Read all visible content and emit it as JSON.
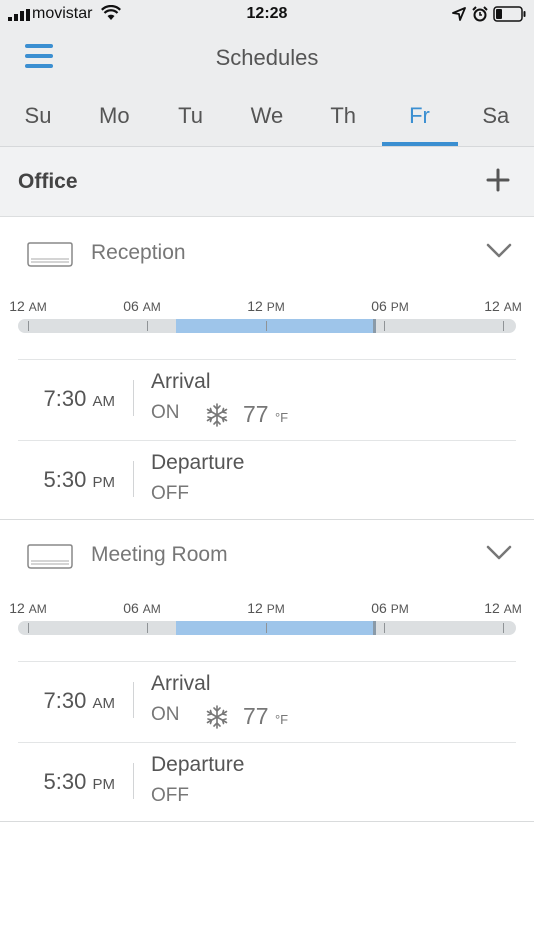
{
  "status_bar": {
    "carrier": "movistar",
    "time": "12:28"
  },
  "nav": {
    "title": "Schedules"
  },
  "days": [
    {
      "label": "Su",
      "active": false
    },
    {
      "label": "Mo",
      "active": false
    },
    {
      "label": "Tu",
      "active": false
    },
    {
      "label": "We",
      "active": false
    },
    {
      "label": "Th",
      "active": false
    },
    {
      "label": "Fr",
      "active": true
    },
    {
      "label": "Sa",
      "active": false
    }
  ],
  "group": {
    "title": "Office"
  },
  "timeline_labels": [
    {
      "num": "12",
      "ampm": "AM"
    },
    {
      "num": "06",
      "ampm": "AM"
    },
    {
      "num": "12",
      "ampm": "PM"
    },
    {
      "num": "06",
      "ampm": "PM"
    },
    {
      "num": "12",
      "ampm": "AM"
    }
  ],
  "devices": [
    {
      "name": "Reception",
      "on_from_hour": 7.5,
      "on_to_hour": 17.5,
      "events": [
        {
          "time": "7:30",
          "ampm": "AM",
          "name": "Arrival",
          "state": "ON",
          "mode_icon": "snowflake-icon",
          "temp": "77",
          "unit": "°F"
        },
        {
          "time": "5:30",
          "ampm": "PM",
          "name": "Departure",
          "state": "OFF"
        }
      ]
    },
    {
      "name": "Meeting Room",
      "on_from_hour": 7.5,
      "on_to_hour": 17.5,
      "events": [
        {
          "time": "7:30",
          "ampm": "AM",
          "name": "Arrival",
          "state": "ON",
          "mode_icon": "snowflake-icon",
          "temp": "77",
          "unit": "°F"
        },
        {
          "time": "5:30",
          "ampm": "PM",
          "name": "Departure",
          "state": "OFF"
        }
      ]
    }
  ],
  "colors": {
    "accent": "#3b8fd1",
    "active_range": "#9ec5ea",
    "track": "#dcdfe1"
  }
}
